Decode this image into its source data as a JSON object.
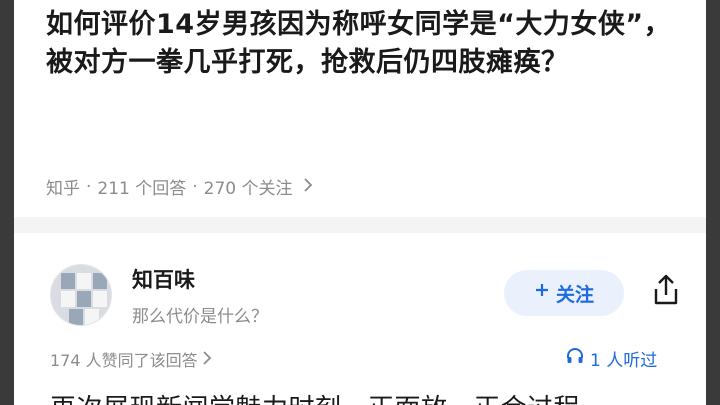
{
  "question": {
    "title": "如何评价14岁男孩因为称呼女同学是“大力女侠”，被对方一拳几乎打死，抢救后仍四肢瘫痪？",
    "source": "知乎",
    "answers": "211 个回答",
    "followers": "270 个关注"
  },
  "answer": {
    "author_name": "知百味",
    "author_bio": "那么代价是什么？",
    "follow_label": "关注",
    "likes": "174 人赞同了该回答",
    "listened": "1 人听过",
    "preview_text": "再次展现新闻学魅力时刻，正面放，正合过程"
  },
  "colors": {
    "accent": "#1f6ae0",
    "follow_bg": "#eaf1fd",
    "meta_text": "#8c8c8c",
    "title_text": "#1a1a1a"
  },
  "icons": {
    "follow": "plus-icon",
    "share": "share-icon",
    "listen": "headphones-icon",
    "chevron": "chevron-right-icon"
  }
}
